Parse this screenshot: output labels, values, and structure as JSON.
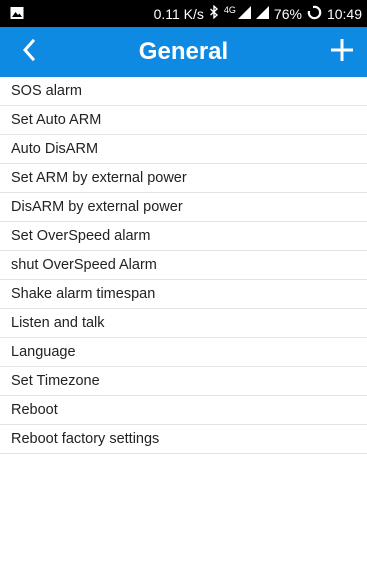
{
  "status_bar": {
    "network_speed": "0.11 K/s",
    "network_type": "4G",
    "battery": "76%",
    "time": "10:49"
  },
  "header": {
    "title": "General"
  },
  "menu_items": [
    "SOS alarm",
    "Set Auto ARM",
    "Auto DisARM",
    "Set ARM by external power",
    "DisARM by external power",
    "Set OverSpeed alarm",
    "shut OverSpeed Alarm",
    "Shake alarm timespan",
    "Listen and talk",
    "Language",
    "Set Timezone",
    "Reboot",
    "Reboot factory settings"
  ],
  "colors": {
    "header_bg": "#0f8ae3",
    "status_bg": "#000000",
    "text": "#222222"
  }
}
